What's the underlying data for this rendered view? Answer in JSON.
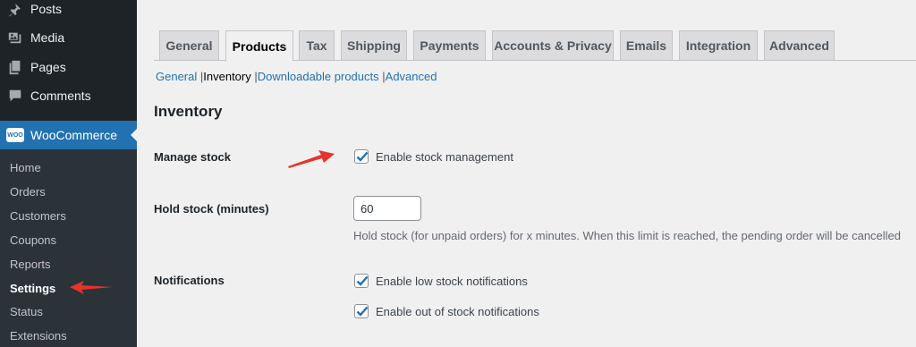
{
  "sidebar": {
    "top_items": [
      {
        "label": "Posts",
        "icon": "pin-icon"
      },
      {
        "label": "Media",
        "icon": "media-icon"
      },
      {
        "label": "Pages",
        "icon": "pages-icon"
      },
      {
        "label": "Comments",
        "icon": "comment-icon"
      }
    ],
    "woocommerce": {
      "label": "WooCommerce",
      "logo_text": "WOO"
    },
    "submenu": [
      "Home",
      "Orders",
      "Customers",
      "Coupons",
      "Reports",
      "Settings",
      "Status",
      "Extensions"
    ],
    "current_submenu": "Settings"
  },
  "tabs": [
    "General",
    "Products",
    "Tax",
    "Shipping",
    "Payments",
    "Accounts & Privacy",
    "Emails",
    "Integration",
    "Advanced"
  ],
  "active_tab": "Products",
  "sections": {
    "items": [
      "General",
      "Inventory",
      "Downloadable products",
      "Advanced"
    ],
    "current": "Inventory",
    "separator": "|"
  },
  "page": {
    "title": "Inventory",
    "manage_stock": {
      "label": "Manage stock",
      "checkbox_label": "Enable stock management",
      "checked": true
    },
    "hold_stock": {
      "label": "Hold stock (minutes)",
      "value": "60",
      "description": "Hold stock (for unpaid orders) for x minutes. When this limit is reached, the pending order will be cancelled"
    },
    "notifications": {
      "label": "Notifications",
      "low_stock_label": "Enable low stock notifications",
      "out_of_stock_label": "Enable out of stock notifications",
      "low_checked": true,
      "out_checked": true
    }
  },
  "colors": {
    "accent": "#2271b1",
    "sidebar_bg": "#1d2327",
    "annotation_arrow": "#e8322b"
  }
}
